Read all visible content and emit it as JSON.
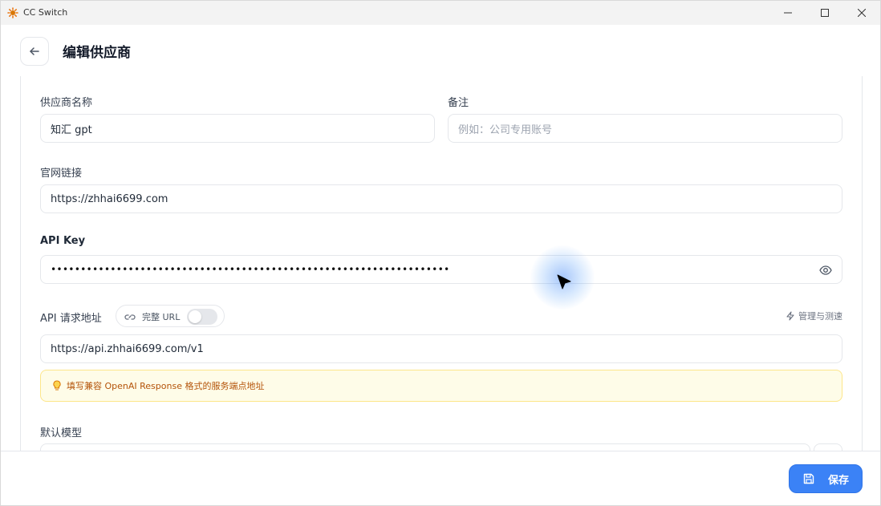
{
  "window": {
    "title": "CC Switch",
    "controls": [
      "minimize-icon",
      "maximize-icon",
      "close-icon"
    ]
  },
  "header": {
    "back_icon": "arrow-left-icon",
    "title": "编辑供应商"
  },
  "form": {
    "provider_name": {
      "label": "供应商名称",
      "value": "知汇 gpt"
    },
    "note": {
      "label": "备注",
      "placeholder": "例如：公司专用账号"
    },
    "website": {
      "label": "官网链接",
      "value": "https://zhhai6699.com"
    },
    "api_key": {
      "label": "API Key",
      "value": "•••••••••••••••••••••••••••••••••••••••••••••••••••••••••••••••••••",
      "toggle_icon": "eye-icon"
    },
    "api_url": {
      "label": "API 请求地址",
      "full_url_label": "完整 URL",
      "full_url_enabled": false,
      "manage_label": "管理与测速",
      "value": "https://api.zhhai6699.com/v1",
      "hint": "填写兼容 OpenAI Response 格式的服务端点地址"
    },
    "default_model": {
      "label": "默认模型"
    }
  },
  "footer": {
    "save_label": "保存",
    "save_icon": "save-icon"
  },
  "colors": {
    "accent": "#3b82f6",
    "hint_bg": "#fefce8",
    "hint_text": "#b45309"
  }
}
